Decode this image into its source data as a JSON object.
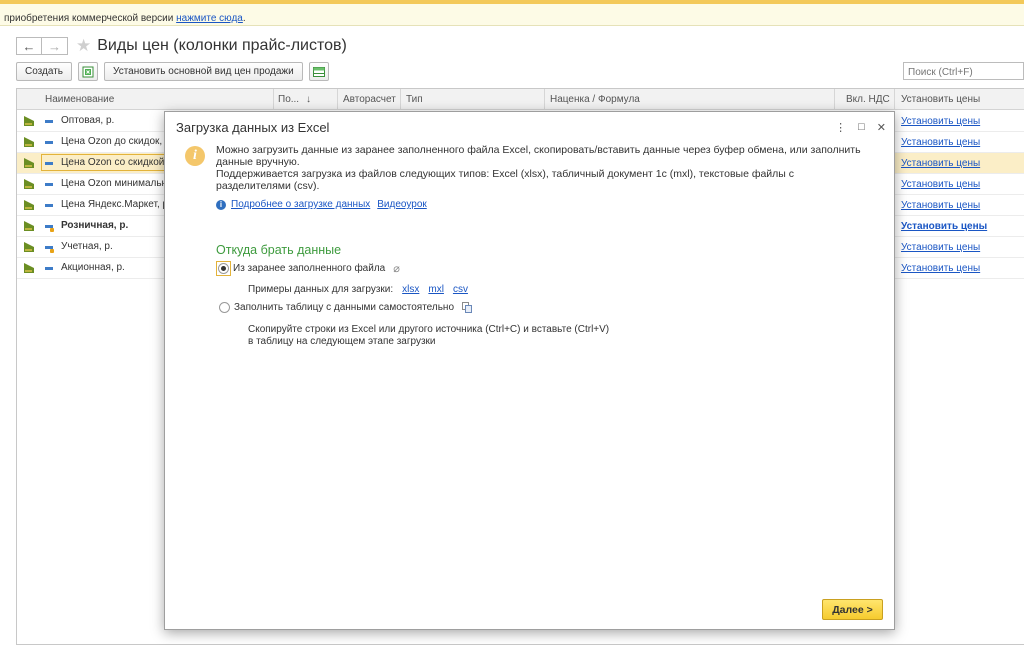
{
  "banner": {
    "text": "приобретения коммерческой версии ",
    "link": "нажмите сюда",
    "tail": "."
  },
  "window": {
    "title": "Виды цен (колонки прайс-листов)",
    "back": "←",
    "forward": "→",
    "star": "★"
  },
  "toolbar": {
    "create_label": "Создать",
    "set_main_label": "Установить основной вид цен продажи",
    "search_placeholder": "Поиск (Ctrl+F)"
  },
  "grid": {
    "columns": {
      "name": "Наименование",
      "pos": "По...",
      "sort_arrow": "↓",
      "autocalc": "Авторасчет",
      "type": "Тип",
      "markup": "Наценка / Формула",
      "vat": "Вкл. НДС",
      "set_prices": "Установить цены"
    },
    "rows": [
      {
        "name": "Оптовая, р.",
        "link": "Установить цены"
      },
      {
        "name": "Цена Ozon до скидок,",
        "link": "Установить цены"
      },
      {
        "name": "Цена Ozon со скидкой",
        "link": "Установить цены"
      },
      {
        "name": "Цена Ozon минимальн",
        "link": "Установить цены"
      },
      {
        "name": "Цена Яндекс.Маркет, р",
        "link": "Установить цены"
      },
      {
        "name": "Розничная, р.",
        "link": "Установить цены"
      },
      {
        "name": "Учетная, р.",
        "link": "Установить цены"
      },
      {
        "name": "Акционная, р.",
        "link": "Установить цены"
      }
    ]
  },
  "dialog": {
    "title": "Загрузка данных из Excel",
    "controls": {
      "menu": "⋮",
      "maximize": "□",
      "close": "✕"
    },
    "info_line1": "Можно загрузить данные из заранее заполненного файла Excel, скопировать/вставить данные через буфер обмена, или заполнить",
    "info_line2": "данные вручную.",
    "info_line3": "Поддерживается загрузка из файлов следующих типов: Excel (xlsx), табличный документ 1с (mxl), текстовые файлы с",
    "info_line4": "разделителями (csv).",
    "more_link": "Подробнее о загрузке данных",
    "video_link": "Видеоурок",
    "section_title": "Откуда брать данные",
    "option_file": "Из заранее заполненного файла",
    "examples_label": "Примеры данных для загрузки:",
    "examples": [
      "xlsx",
      "mxl",
      "csv"
    ],
    "option_manual": "Заполнить таблицу с данными самостоятельно",
    "hint_line1": "Скопируйте строки из Excel или другого источника (Ctrl+C) и вставьте (Ctrl+V)",
    "hint_line2": "в таблицу на следующем этапе загрузки",
    "next_button": "Далее >"
  }
}
